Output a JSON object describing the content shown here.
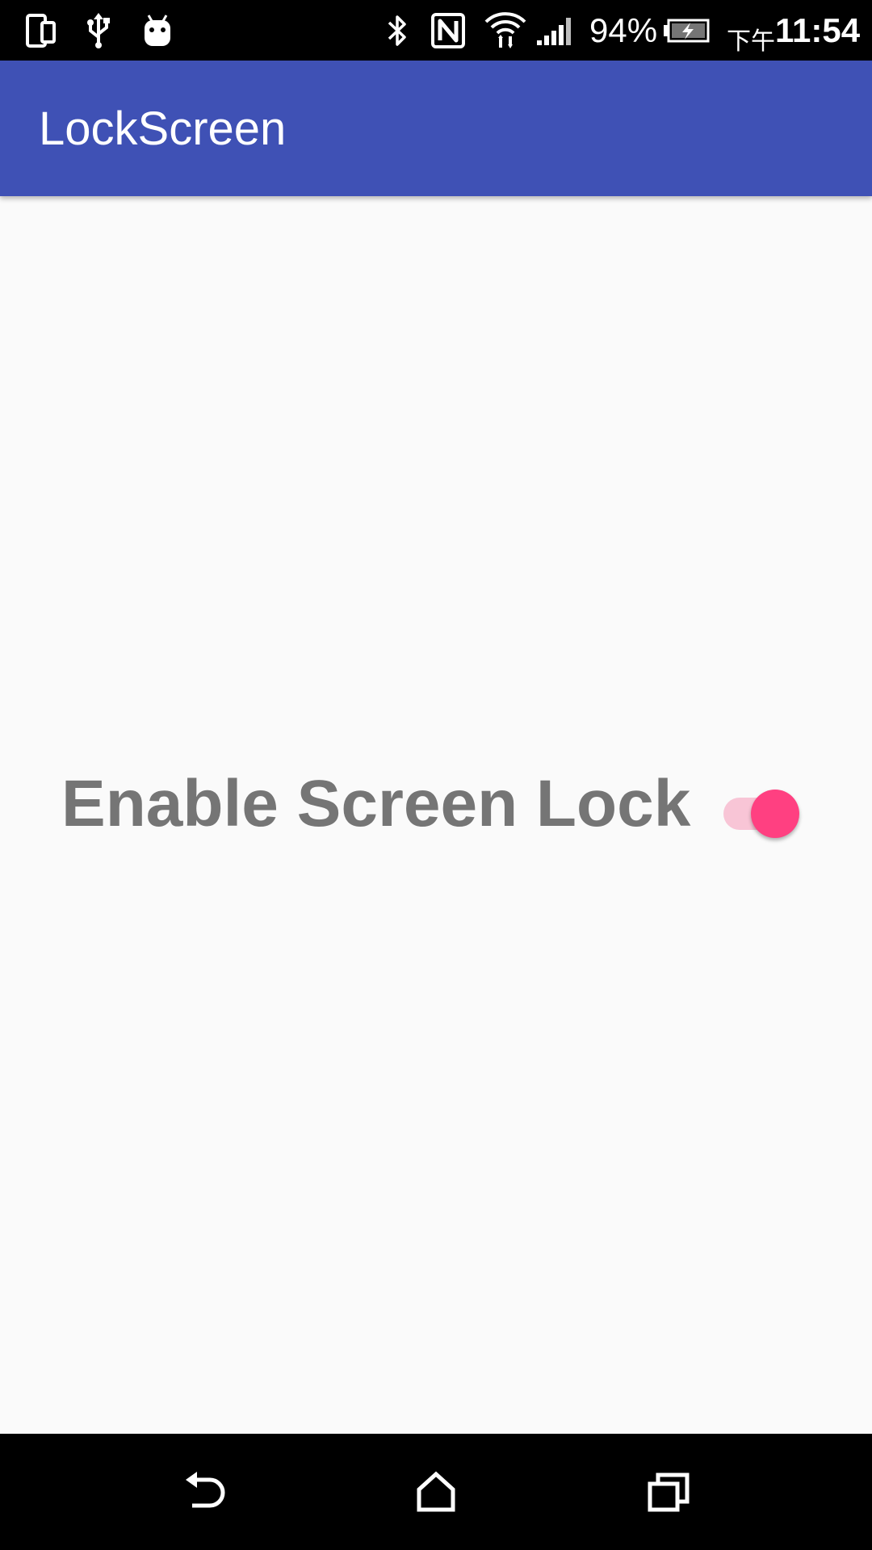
{
  "status_bar": {
    "battery_percent": "94%",
    "time_prefix": "下午",
    "time": "11:54",
    "left_icons": [
      "screen-mirror-icon",
      "usb-icon",
      "android-debug-icon"
    ],
    "right_icons": [
      "bluetooth-icon",
      "nfc-icon",
      "wifi-icon",
      "signal-icon",
      "battery-charging-icon"
    ]
  },
  "app_bar": {
    "title": "LockScreen",
    "color": "#3f51b5"
  },
  "settings": {
    "lock_label": "Enable Screen Lock",
    "lock_enabled": true,
    "accent_color": "#ff4081"
  },
  "nav_bar": {
    "buttons": [
      "back-icon",
      "home-icon",
      "recents-icon"
    ]
  }
}
